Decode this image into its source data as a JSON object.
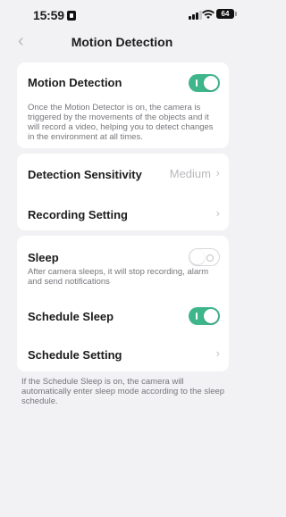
{
  "status_bar": {
    "time": "15:59",
    "battery": "64"
  },
  "header": {
    "title": "Motion Detection",
    "back_icon": "chevron-left-icon"
  },
  "motion": {
    "label": "Motion Detection",
    "enabled": true,
    "description": "Once the Motion Detector is on, the camera is triggered by the movements of the objects and it will record a video, helping you to detect changes in the environment at all times."
  },
  "settings": {
    "sensitivity_label": "Detection Sensitivity",
    "sensitivity_value": "Medium",
    "recording_label": "Recording Setting"
  },
  "sleep": {
    "sleep_label": "Sleep",
    "sleep_enabled": false,
    "sleep_description": "After camera sleeps, it will stop recording, alarm and send notifications",
    "schedule_sleep_label": "Schedule Sleep",
    "schedule_sleep_enabled": true,
    "schedule_setting_label": "Schedule Setting"
  },
  "footer_note": "If the Schedule Sleep is on, the camera will automatically enter sleep mode according to the sleep schedule.",
  "colors": {
    "accent": "#3fb58c",
    "background": "#f2f2f4",
    "card": "#ffffff"
  }
}
